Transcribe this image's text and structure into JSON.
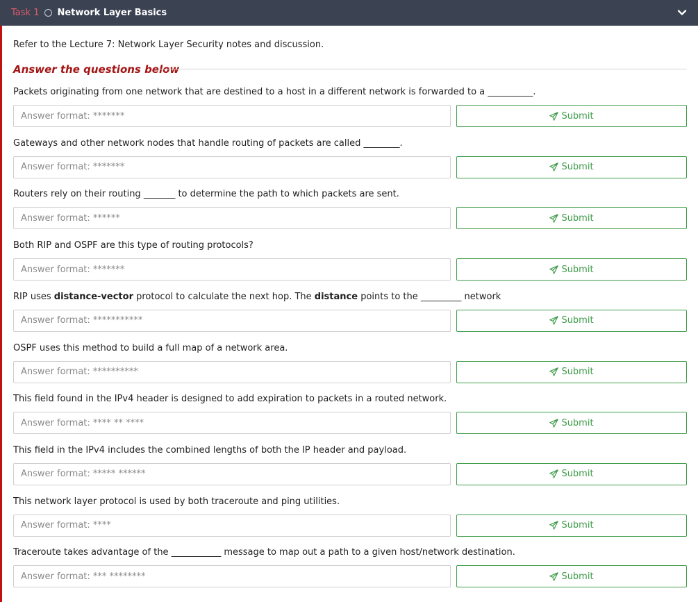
{
  "header": {
    "task_label": "Task 1",
    "title": "Network Layer Basics",
    "expand_icon": "chevron-down-icon",
    "status_icon": "circle-outline-icon"
  },
  "intro": "Refer to the Lecture 7: Network Layer Security notes and discussion.",
  "section_title": "Answer the questions below",
  "submit_label": "Submit",
  "submit_icon": "paper-plane-icon",
  "colors": {
    "header_bg": "#3b4252",
    "accent_red": "#c11111",
    "submit_green": "#3f9c4a"
  },
  "questions": [
    {
      "parts": [
        {
          "t": "Packets originating from one network that are destined to a host in a different network is forwarded to a __________."
        }
      ],
      "placeholder": "Answer format: *******"
    },
    {
      "parts": [
        {
          "t": "Gateways and other network nodes that handle routing of packets are called  ________."
        }
      ],
      "placeholder": "Answer format: *******"
    },
    {
      "parts": [
        {
          "t": "Routers rely on their routing _______ to determine the path to which packets are sent."
        }
      ],
      "placeholder": "Answer format: ******"
    },
    {
      "parts": [
        {
          "t": "Both RIP and OSPF are this type of routing protocols?"
        }
      ],
      "placeholder": "Answer format: *******"
    },
    {
      "parts": [
        {
          "t": "RIP uses "
        },
        {
          "t": "distance-vector",
          "b": true
        },
        {
          "t": " protocol to calculate the next hop.  The "
        },
        {
          "t": "distance",
          "b": true
        },
        {
          "t": " points to the _________ network"
        }
      ],
      "placeholder": "Answer format: ***********"
    },
    {
      "parts": [
        {
          "t": "OSPF uses this method to build a full map of a network area."
        }
      ],
      "placeholder": "Answer format: **********"
    },
    {
      "parts": [
        {
          "t": "This field found in the IPv4 header is designed to add expiration to packets in a routed network."
        }
      ],
      "placeholder": "Answer format: **** ** ****"
    },
    {
      "parts": [
        {
          "t": "This field in the IPv4 includes the combined lengths of both the IP header and payload."
        }
      ],
      "placeholder": "Answer format: ***** ******"
    },
    {
      "parts": [
        {
          "t": "This network layer protocol is used by both traceroute and ping utilities."
        }
      ],
      "placeholder": "Answer format: ****"
    },
    {
      "parts": [
        {
          "t": "Traceroute takes advantage of the ___________ message to map out a path to a given host/network destination."
        }
      ],
      "placeholder": "Answer format: *** ********"
    }
  ]
}
